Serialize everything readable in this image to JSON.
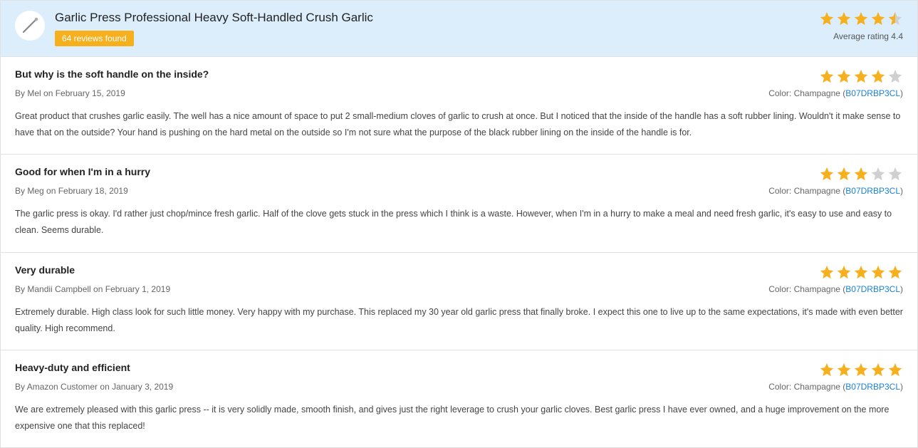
{
  "header": {
    "product_title": "Garlic Press Professional Heavy Soft-Handled Crush Garlic",
    "reviews_badge": "64 reviews found",
    "avg_rating_label": "Average rating 4.4",
    "avg_stars": 4.5
  },
  "labels": {
    "by_prefix": "By ",
    "on_prefix": " on ",
    "color_prefix": "Color: ",
    "paren_open": "(",
    "paren_close": ")"
  },
  "reviews": [
    {
      "title": "But why is the soft handle on the inside?",
      "author": "Mel",
      "date": "February 15, 2019",
      "stars": 4,
      "color": "Champagne ",
      "asin": "B07DRBP3CL",
      "body": "Great product that crushes garlic easily. The well has a nice amount of space to put 2 small-medium cloves of garlic to crush at once. But I noticed that the inside of the handle has a soft rubber lining. Wouldn't it make sense to have that on the outside? Your hand is pushing on the hard metal on the outside so I'm not sure what the purpose of the black rubber lining on the inside of the handle is for."
    },
    {
      "title": "Good for when I'm in a hurry",
      "author": "Meg",
      "date": "February 18, 2019",
      "stars": 3,
      "color": "Champagne ",
      "asin": "B07DRBP3CL",
      "body": "The garlic press is okay. I'd rather just chop/mince fresh garlic. Half of the clove gets stuck in the press which I think is a waste. However, when I'm in a hurry to make a meal and need fresh garlic, it's easy to use and easy to clean. Seems durable."
    },
    {
      "title": "Very durable",
      "author": "Mandii Campbell",
      "date": "February 1, 2019",
      "stars": 5,
      "color": "Champagne ",
      "asin": "B07DRBP3CL",
      "body": "Extremely durable. High class look for such little money. Very happy with my purchase. This replaced my 30 year old garlic press that finally broke. I expect this one to live up to the same expectations, it's made with even better quality. High recommend."
    },
    {
      "title": "Heavy-duty and efficient",
      "author": "Amazon Customer",
      "date": "January 3, 2019",
      "stars": 5,
      "color": "Champagne ",
      "asin": "B07DRBP3CL",
      "body": "We are extremely pleased with this garlic press -- it is very solidly made, smooth finish, and gives just the right leverage to crush your garlic cloves. Best garlic press I have ever owned, and a huge improvement on the more expensive one that this replaced!"
    }
  ]
}
